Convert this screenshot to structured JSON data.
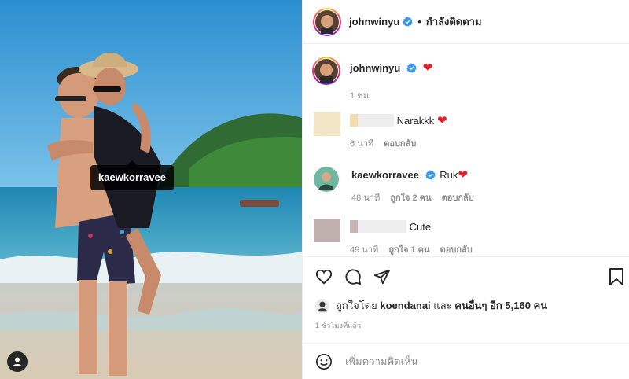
{
  "photo": {
    "tag_label": "kaewkorravee",
    "tags_icon": "user-icon"
  },
  "header": {
    "username": "johnwinyu",
    "separator": "•",
    "following_label": "กำลังติดตาม",
    "verified_icon": "verified-badge-icon"
  },
  "caption": {
    "username": "johnwinyu",
    "emoji": "❤",
    "time": "1 ชม."
  },
  "comments": [
    {
      "text": "Narakkk",
      "emoji": "❤",
      "time": "6 นาที",
      "reply_label": "ตอบกลับ"
    },
    {
      "username": "kaewkorravee",
      "text": "Ruk",
      "emoji": "❤",
      "time": "48 นาที",
      "likes": "ถูกใจ 2 คน",
      "reply_label": "ตอบกลับ"
    },
    {
      "text": "Cute",
      "time": "49 นาที",
      "likes": "ถูกใจ 1 คน",
      "reply_label": "ตอบกลับ"
    }
  ],
  "actions": {
    "icons": [
      "heart-icon",
      "comment-icon",
      "share-icon",
      "bookmark-icon"
    ]
  },
  "likes": {
    "prefix": "ถูกใจโดย",
    "user": "koendanai",
    "middle": "และ",
    "others": "คนอื่นๆ อีก 5,160 คน"
  },
  "post_time": "1 ชั่วโมงที่แล้ว",
  "add_comment": {
    "placeholder": "เพิ่มความคิดเห็น",
    "emoji_icon": "smiley-icon"
  },
  "colors": {
    "heart": "#ed1c24",
    "verified": "#3897f0",
    "meta_gray": "#8e8e8e"
  }
}
